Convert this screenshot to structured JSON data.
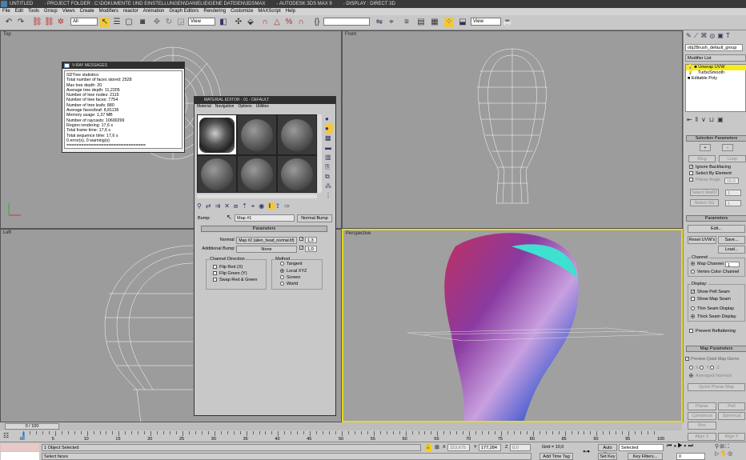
{
  "titlebar": {
    "doc": "UNTITLED",
    "project": "- PROJECT FOLDER : C:\\DOKUMENTE UND EINSTELLUNGEN\\DANIEL\\EIGENE DATEIEN\\3DSMAX",
    "app": "- AUTODESK 3DS MAX 9",
    "display": "- DISPLAY : DIRECT 3D"
  },
  "menu": [
    "File",
    "Edit",
    "Tools",
    "Group",
    "Views",
    "Create",
    "Modifiers",
    "reactor",
    "Animation",
    "Graph Editors",
    "Rendering",
    "Customize",
    "MAXScript",
    "Help"
  ],
  "toolbar": {
    "selection_filter": "All",
    "ref_coord": "View",
    "ref_coord2": "View"
  },
  "viewports": {
    "top": "Top",
    "front": "Front",
    "left": "Left",
    "perspective": "Perspective"
  },
  "vray": {
    "title": "V-RAY MESSAGES",
    "lines": [
      "SDTree statistics:",
      "Total number of faces stored: 2528",
      "Max tree depth: 20",
      "Average tree depth: 11,2205",
      "Number of tree nodes: 2115",
      "Number of tree faces: 7754",
      "Number of tree leafs: 880",
      "Average faces/leaf: 8,81136",
      "Memory usage: 1,37 MB",
      "Number of raycasts: 10600299",
      "Region rendering: 17,6 s",
      "Total frame time: 17,6 s",
      "Total sequence time: 17,6 s",
      "0 error(s), 0 warning(s)",
      "================================"
    ]
  },
  "mated": {
    "title": "MATERIAL EDITOR - 01 - DEFAULT",
    "menu": [
      "Material",
      "Navigation",
      "Options",
      "Utilities"
    ],
    "bump_label": "Bump:",
    "bump_map": "Map #1",
    "bump_type": "Normal Bump",
    "params_title": "Parameters",
    "normal_label": "Normal:",
    "normal_map": "Map #2 (alien_head_normal.tif)",
    "normal_amount": "1,3",
    "addbump_label": "Additional Bump:",
    "addbump_map": "None",
    "addbump_amount": "1,0",
    "channel_dir": "Channel Direction",
    "flip_red": "Flip Red (X)",
    "flip_green": "Flip Green (Y)",
    "swap": "Swap Red & Green",
    "method": "Method",
    "tangent": "Tangent",
    "local": "Local XYZ",
    "screen": "Screen",
    "world": "World"
  },
  "cmd": {
    "object_name": "obj2Brush_default_group",
    "modifier_list": "Modifier List",
    "stack": [
      "Unwrap UVW",
      "TurboSmooth",
      "Editable Poly"
    ],
    "sel_params": "Selection Parameters",
    "plus": "+",
    "minus": "-",
    "ring": "Ring",
    "loop": "Loop",
    "ignore_backfacing": "Ignore Backfacing",
    "select_by_element": "Select By Element",
    "planar_angle": "Planar Angle",
    "planar_angle_val": "15,0",
    "select_matid": "Select MatID",
    "select_sg": "Select SG",
    "one": "1",
    "params": "Parameters",
    "edit": "Edit...",
    "reset": "Reset UVW's",
    "save": "Save...",
    "load": "Load...",
    "channel": "Channel",
    "map_channel": "Map Channel:",
    "map_channel_val": "1",
    "vertex_color": "Vertex Color Channel",
    "display": "Display:",
    "show_pelt": "Show Pelt Seam",
    "show_map": "Show Map Seam",
    "thin": "Thin Seam Display",
    "thick": "Thick Seam Display",
    "prevent": "Prevent Reflattening",
    "map_params": "Map Parameters",
    "preview": "Preview Quick Map Gizmo",
    "x": "X",
    "y": "Y",
    "z": "Z",
    "avg": "Averaged Normals",
    "quick_planar": "Quick Planar Map",
    "planar": "Planar",
    "pelt": "Pelt",
    "cylindrical": "Cylindrical",
    "spherical": "Spherical",
    "box": "Box",
    "align_x": "Align X",
    "align_y": "Align Y"
  },
  "timeline": {
    "frame": "0 / 100",
    "ticks": [
      "0",
      "5",
      "10",
      "15",
      "20",
      "25",
      "30",
      "35",
      "40",
      "45",
      "50",
      "55",
      "60",
      "65",
      "70",
      "75",
      "80",
      "85",
      "90",
      "95",
      "100"
    ]
  },
  "status": {
    "selected": "1 Object Selected",
    "prompt": "Select faces",
    "x_label": "X",
    "x": "153,675",
    "y_label": "Y",
    "y": "177,284",
    "z_label": "Z",
    "z": "0,0",
    "grid": "Grid = 10,0",
    "add_time_tag": "Add Time Tag",
    "auto_key": "Auto Key",
    "set_key": "Set Key",
    "key_mode": "Selected",
    "key_filters": "Key Filters...",
    "frame_val": "0"
  }
}
